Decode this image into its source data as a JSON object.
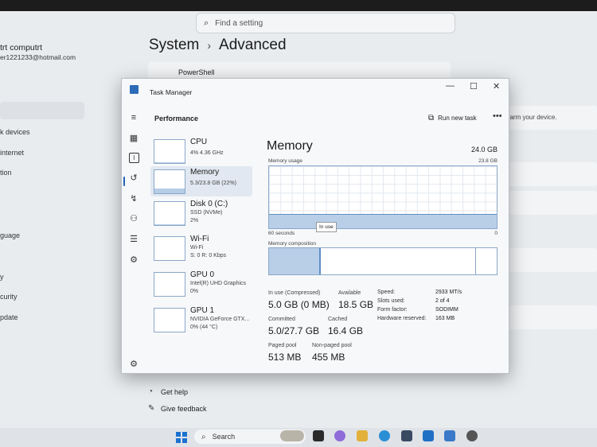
{
  "settings": {
    "search_placeholder": "Find a setting",
    "account_name": "trt computrt",
    "account_email": "er1221233@hotmail.com",
    "nav": [
      "k devices",
      "internet",
      "tion",
      "guage",
      "y",
      "curity",
      "pdate"
    ],
    "breadcrumb_parent": "System",
    "breadcrumb_sep": "›",
    "breadcrumb_current": "Advanced",
    "powershell": "PowerShell",
    "charm_text": "harm your device.",
    "get_help": "Get help",
    "give_feedback": "Give feedback"
  },
  "taskbar": {
    "search": "Search"
  },
  "task_manager": {
    "title": "Task Manager",
    "section": "Performance",
    "run_new_task": "Run new task",
    "more": "•••",
    "items": [
      {
        "name": "CPU",
        "sub1": "4% 4.36 GHz",
        "sub2": "",
        "level": 0.04
      },
      {
        "name": "Memory",
        "sub1": "5.3/23.8 GB (22%)",
        "sub2": "",
        "level": 0.22
      },
      {
        "name": "Disk 0 (C:)",
        "sub1": "SSD (NVMe)",
        "sub2": "2%",
        "level": 0.02
      },
      {
        "name": "Wi-Fi",
        "sub1": "Wi-Fi",
        "sub2": "S: 0 R: 0 Kbps",
        "level": 0.0
      },
      {
        "name": "GPU 0",
        "sub1": "Intel(R) UHD Graphics",
        "sub2": "0%",
        "level": 0.0
      },
      {
        "name": "GPU 1",
        "sub1": "NVIDIA GeForce GTX...",
        "sub2": "0% (44 °C)",
        "level": 0.0
      }
    ],
    "memory": {
      "title": "Memory",
      "capacity": "24.0 GB",
      "usage_label": "Memory usage",
      "usage_max": "23.8 GB",
      "axis_left": "60 seconds",
      "axis_right": "0",
      "usage_level": 0.22,
      "tooltip": "In use",
      "composition_label": "Memory composition",
      "composition_in_use": 0.22,
      "stats": {
        "in_use_label": "In use (Compressed)",
        "in_use_value": "5.0 GB (0 MB)",
        "available_label": "Available",
        "available_value": "18.5 GB",
        "committed_label": "Committed",
        "committed_value": "5.0/27.7 GB",
        "cached_label": "Cached",
        "cached_value": "16.4 GB",
        "paged_label": "Paged pool",
        "paged_value": "513 MB",
        "nonpaged_label": "Non-paged pool",
        "nonpaged_value": "455 MB"
      },
      "details": [
        {
          "k": "Speed:",
          "v": "2933 MT/s"
        },
        {
          "k": "Slots used:",
          "v": "2 of 4"
        },
        {
          "k": "Form factor:",
          "v": "SODIMM"
        },
        {
          "k": "Hardware reserved:",
          "v": "163 MB"
        }
      ]
    }
  },
  "colors": {
    "accent": "#1f63b5",
    "graph_fill": "#b9cfe8",
    "graph_border": "#8aa7c8"
  }
}
